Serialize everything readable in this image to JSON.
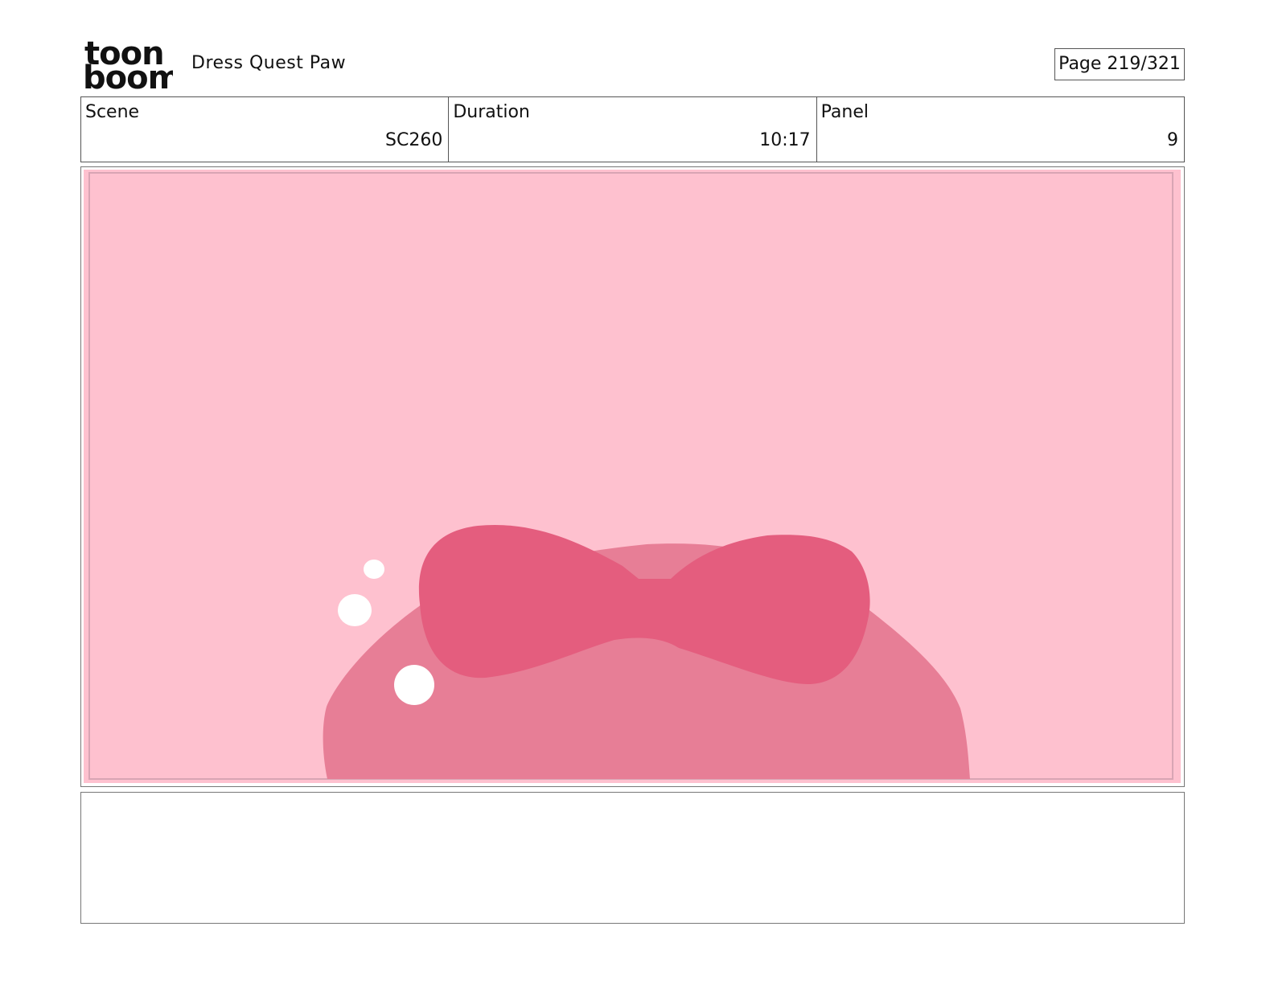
{
  "header": {
    "logo_line1": "toon",
    "logo_line2": "boom",
    "project_title": "Dress Quest Paw",
    "page_indicator": "Page 219/321"
  },
  "info": {
    "scene_label": "Scene",
    "scene_value": "SC260",
    "duration_label": "Duration",
    "duration_value": "10:17",
    "panel_label": "Panel",
    "panel_value": "9"
  },
  "panel": {
    "background_color": "#fec1cf",
    "safe_frame_color": "#d8a5b4",
    "hat_color": "#e77e96",
    "bow_color": "#e45d7e",
    "sparkle_color": "#ffffff"
  },
  "notes": {
    "text": ""
  }
}
